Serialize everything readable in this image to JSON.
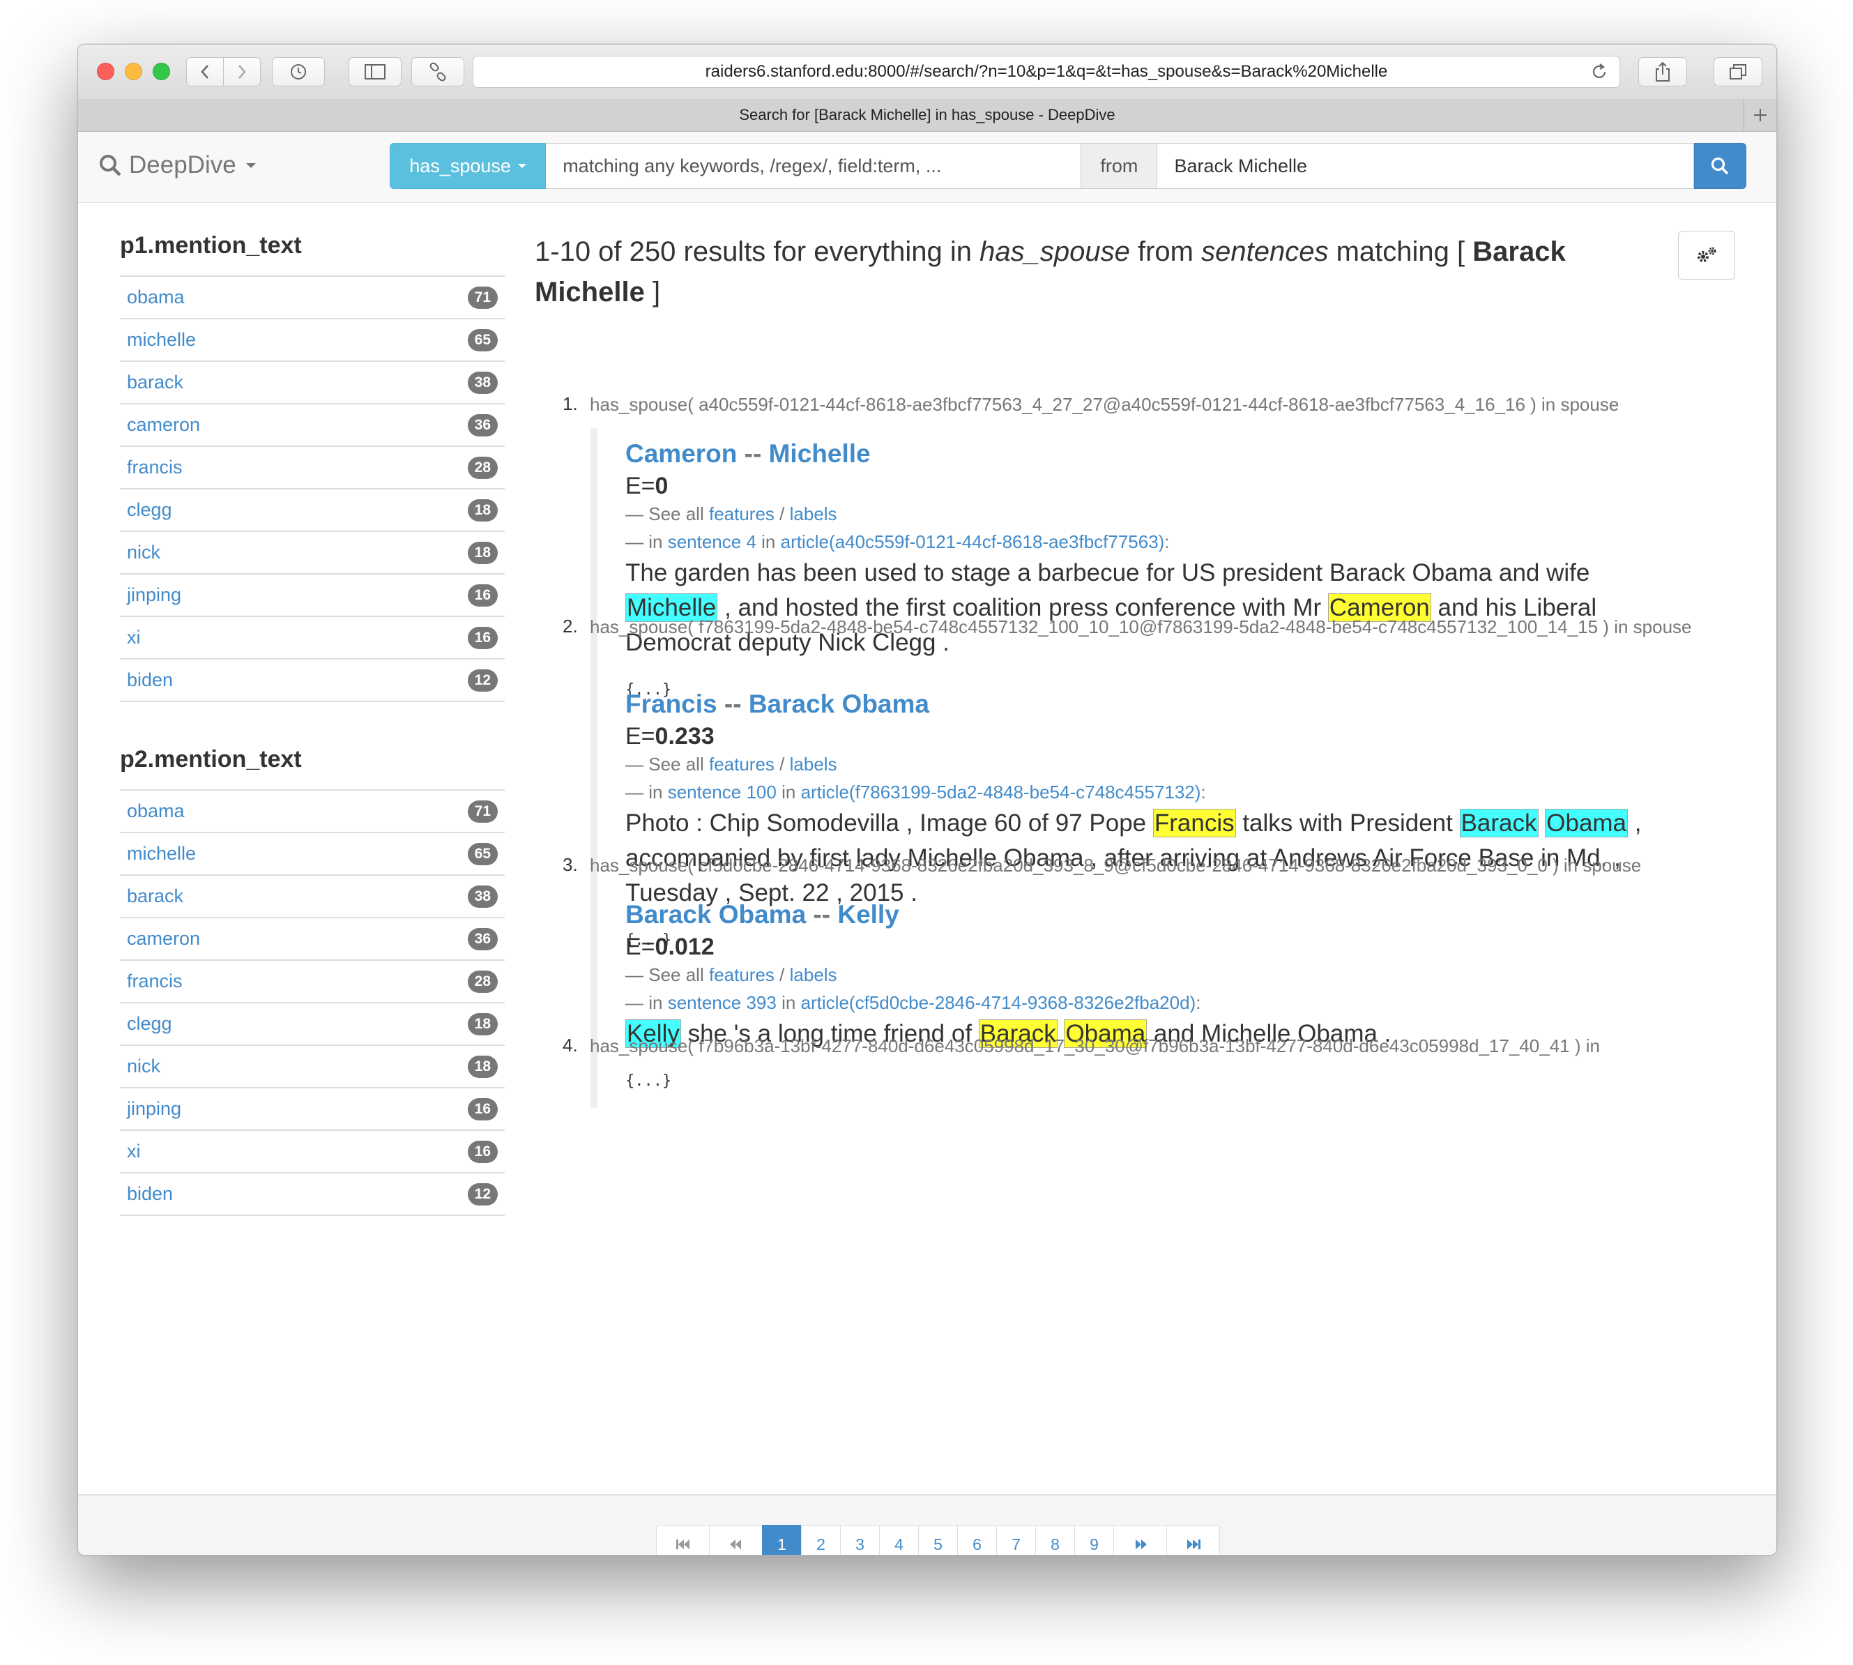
{
  "browser": {
    "url": "raiders6.stanford.edu:8000/#/search/?n=10&p=1&q=&t=has_spouse&s=Barack%20Michelle",
    "tab_title": "Search for [Barack Michelle] in has_spouse - DeepDive"
  },
  "navbar": {
    "brand": "DeepDive",
    "relation_button": "has_spouse",
    "keyword_placeholder": "matching any keywords, /regex/, field:term, ...",
    "from_label": "from",
    "source_value": "Barack Michelle"
  },
  "facets": [
    {
      "title": "p1.mention_text",
      "items": [
        {
          "label": "obama",
          "count": "71"
        },
        {
          "label": "michelle",
          "count": "65"
        },
        {
          "label": "barack",
          "count": "38"
        },
        {
          "label": "cameron",
          "count": "36"
        },
        {
          "label": "francis",
          "count": "28"
        },
        {
          "label": "clegg",
          "count": "18"
        },
        {
          "label": "nick",
          "count": "18"
        },
        {
          "label": "jinping",
          "count": "16"
        },
        {
          "label": "xi",
          "count": "16"
        },
        {
          "label": "biden",
          "count": "12"
        }
      ]
    },
    {
      "title": "p2.mention_text",
      "items": [
        {
          "label": "obama",
          "count": "71"
        },
        {
          "label": "michelle",
          "count": "65"
        },
        {
          "label": "barack",
          "count": "38"
        },
        {
          "label": "cameron",
          "count": "36"
        },
        {
          "label": "francis",
          "count": "28"
        },
        {
          "label": "clegg",
          "count": "18"
        },
        {
          "label": "nick",
          "count": "18"
        },
        {
          "label": "jinping",
          "count": "16"
        },
        {
          "label": "xi",
          "count": "16"
        },
        {
          "label": "biden",
          "count": "12"
        }
      ]
    }
  ],
  "summary": {
    "range": "1-10 of 250 results for everything in",
    "relation": "has_spouse",
    "from_word": "from",
    "source": "sentences",
    "matching": "matching [",
    "query": "Barack Michelle",
    "close_bracket": "]"
  },
  "results": [
    {
      "num": "1.",
      "header": "has_spouse( a40c559f-0121-44cf-8618-ae3fbcf77563_4_27_27@a40c559f-0121-44cf-8618-ae3fbcf77563_4_16_16 ) in spouse",
      "p1": "Cameron",
      "p2": "Michelle",
      "e_label": "E=",
      "e_value": "0",
      "see_all": "— See all",
      "features": "features",
      "slash": "/",
      "labels": "labels",
      "in_dash": "—  in",
      "sentence_link": "sentence 4",
      "in_word": "in",
      "article_link": "article(a40c559f-0121-44cf-8618-ae3fbcf77563)",
      "colon": ":",
      "text": [
        {
          "t": "The garden has been used to stage a barbecue for US president Barack Obama and wife "
        },
        {
          "t": "Michelle",
          "hl": "c"
        },
        {
          "t": " , and hosted the first coalition press conference with Mr "
        },
        {
          "t": "Cameron",
          "hl": "y"
        },
        {
          "t": " and his Liberal Democrat deputy Nick Clegg ."
        }
      ],
      "ellipsis": "{...}"
    },
    {
      "num": "2.",
      "header": "has_spouse( f7863199-5da2-4848-be54-c748c4557132_100_10_10@f7863199-5da2-4848-be54-c748c4557132_100_14_15 ) in spouse",
      "p1": "Francis",
      "p2": "Barack Obama",
      "e_label": "E=",
      "e_value": "0.233",
      "see_all": "— See all",
      "features": "features",
      "slash": "/",
      "labels": "labels",
      "in_dash": "—  in",
      "sentence_link": "sentence 100",
      "in_word": "in",
      "article_link": "article(f7863199-5da2-4848-be54-c748c4557132)",
      "colon": ":",
      "text": [
        {
          "t": "Photo : Chip Somodevilla , Image 60 of 97 Pope "
        },
        {
          "t": "Francis",
          "hl": "y"
        },
        {
          "t": " talks with President "
        },
        {
          "t": "Barack",
          "hl": "c"
        },
        {
          "t": " "
        },
        {
          "t": "Obama",
          "hl": "c"
        },
        {
          "t": " , accompanied by first lady Michelle Obama , after arriving at Andrews Air Force Base in Md. , Tuesday , Sept. 22 , 2015 ."
        }
      ],
      "ellipsis": "{...}"
    },
    {
      "num": "3.",
      "header": "has_spouse( cf5d0cbe-2846-4714-9368-8326e2fba20d_393_8_9@cf5d0cbe-2846-4714-9368-8326e2fba20d_393_0_0 ) in spouse",
      "p1": "Barack Obama",
      "p2": "Kelly",
      "e_label": "E=",
      "e_value": "0.012",
      "see_all": "— See all",
      "features": "features",
      "slash": "/",
      "labels": "labels",
      "in_dash": "—  in",
      "sentence_link": "sentence 393",
      "in_word": "in",
      "article_link": "article(cf5d0cbe-2846-4714-9368-8326e2fba20d)",
      "colon": ":",
      "text": [
        {
          "t": "Kelly",
          "hl": "c"
        },
        {
          "t": " she 's a long time friend of "
        },
        {
          "t": "Barack",
          "hl": "y"
        },
        {
          "t": " "
        },
        {
          "t": "Obama",
          "hl": "y"
        },
        {
          "t": " and Michelle Obama ."
        }
      ],
      "ellipsis": "{...}"
    },
    {
      "num": "4.",
      "header": "has_spouse( f7b96b3a-13bf-4277-840d-d6e43c05998d_17_30_30@f7b96b3a-13bf-4277-840d-d6e43c05998d_17_40_41 ) in"
    }
  ],
  "pagination": {
    "pages": [
      "1",
      "2",
      "3",
      "4",
      "5",
      "6",
      "7",
      "8",
      "9"
    ],
    "active": "1"
  },
  "colors": {
    "link": "#428bca",
    "relation_button": "#5bc0de",
    "highlight_cyan": "#44ffff",
    "highlight_yellow": "#ffff33"
  },
  "icons": [
    "search-icon",
    "gear-icon",
    "first-page-icon",
    "prev-page-icon",
    "next-page-icon",
    "last-page-icon"
  ]
}
